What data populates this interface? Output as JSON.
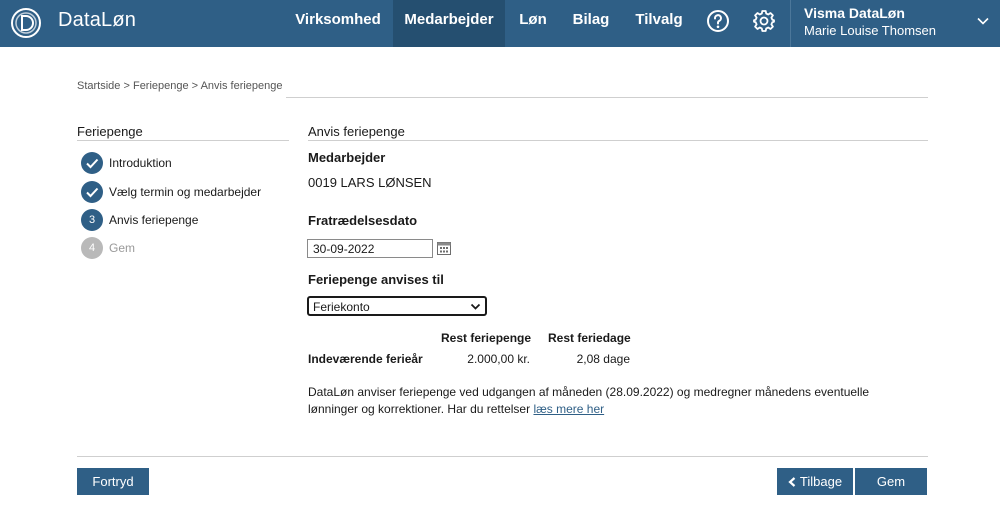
{
  "header": {
    "brand": "DataLøn",
    "nav": [
      {
        "label": "Virksomhed",
        "active": false
      },
      {
        "label": "Medarbejder",
        "active": true
      },
      {
        "label": "Løn",
        "active": false
      },
      {
        "label": "Bilag",
        "active": false
      },
      {
        "label": "Tilvalg",
        "active": false
      }
    ],
    "help_icon": "help-circle-icon",
    "settings_icon": "gear-icon",
    "user": {
      "company": "Visma DataLøn",
      "name": "Marie Louise Thomsen"
    },
    "colors": {
      "bar": "#2f5f86",
      "active": "#254f70"
    }
  },
  "breadcrumb": {
    "items": [
      "Startside",
      "Feriepenge",
      "Anvis feriepenge"
    ],
    "separator": " > "
  },
  "steps": {
    "title": "Feriepenge",
    "items": [
      {
        "number": "1",
        "label": "Introduktion",
        "state": "done"
      },
      {
        "number": "2",
        "label": "Vælg termin og medarbejder",
        "state": "done"
      },
      {
        "number": "3",
        "label": "Anvis feriepenge",
        "state": "current"
      },
      {
        "number": "4",
        "label": "Gem",
        "state": "pending"
      }
    ]
  },
  "content": {
    "title": "Anvis feriepenge",
    "employee_label": "Medarbejder",
    "employee_value": "0019 LARS LØNSEN",
    "date_label": "Fratrædelsesdato",
    "date_value": "30-09-2022",
    "payout_label": "Feriepenge anvises til",
    "payout_selected": "Feriekonto",
    "table": {
      "headers": [
        "Rest feriepenge",
        "Rest feriedage"
      ],
      "row_label": "Indeværende ferieår",
      "rest_feriepenge": "2.000,00 kr.",
      "rest_feriedage": "2,08 dage"
    },
    "info_text": "DataLøn anviser feriepenge ved udgangen af måneden (28.09.2022) og medregner månedens eventuelle lønninger og korrektioner. Har du rettelser ",
    "info_link": "læs mere her"
  },
  "footer": {
    "cancel_label": "Fortryd",
    "back_label": "Tilbage",
    "save_label": "Gem"
  }
}
